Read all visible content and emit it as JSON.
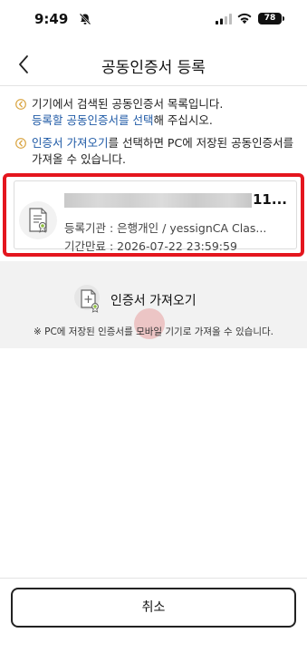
{
  "status_bar": {
    "time": "9:49",
    "battery": "78"
  },
  "header": {
    "title": "공동인증서 등록"
  },
  "notes": {
    "note1": {
      "pre": "기기에서 검색된 공동인증서 목록입니다.",
      "highlight": "등록할 공동인증서를 선택",
      "post": "해 주십시오."
    },
    "note2": {
      "highlight": "인증서 가져오기",
      "post": "를 선택하면 PC에 저장된 공동인증서를 가져올 수 있습니다."
    }
  },
  "certificate": {
    "name_visible_suffix": "11...",
    "issuer_label": "등록기관 : 은행개인 / yessignCA Clas...",
    "expiry_label": "기간만료 : 2026-07-22 23:59:59"
  },
  "import": {
    "label": "인증서 가져오기",
    "note": "※ PC에 저장된 인증서를 모바일 기기로 가져올 수 있습니다."
  },
  "footer": {
    "cancel_label": "취소"
  },
  "colors": {
    "highlight": "#1f5aa6",
    "note_icon": "#d9a441",
    "selection_border": "#e4161e",
    "import_bg": "#f2f2f2"
  },
  "icons": [
    "bell-slash-icon",
    "signal-icon",
    "wifi-icon",
    "back-chevron-icon",
    "info-icon",
    "certificate-icon",
    "import-certificate-icon"
  ]
}
